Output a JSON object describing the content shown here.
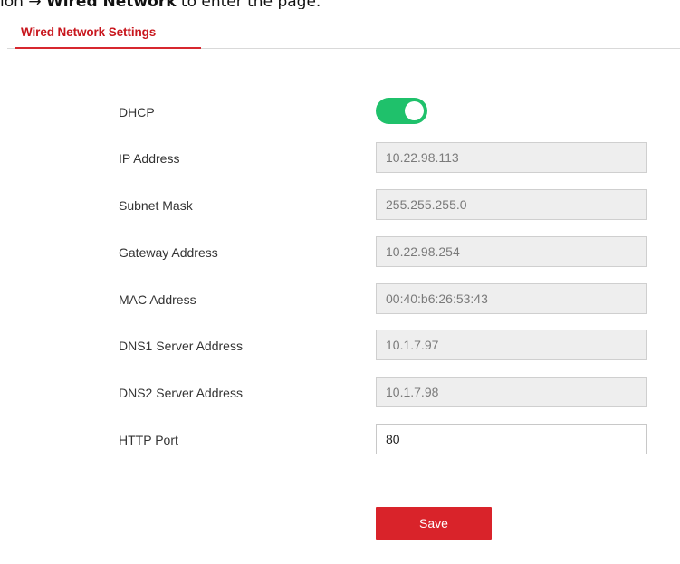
{
  "caption": {
    "prefix": "ion",
    "arrow": "→",
    "bold": "Wired Network",
    "suffix": "to enter the page."
  },
  "tab": {
    "label": "Wired Network Settings"
  },
  "accent_color": "#d7282f",
  "toggle_color": "#1fc16b",
  "dhcp": {
    "label": "DHCP",
    "enabled": true
  },
  "fields": {
    "ip": {
      "label": "IP Address",
      "value": "10.22.98.113"
    },
    "subnet": {
      "label": "Subnet Mask",
      "value": "255.255.255.0"
    },
    "gateway": {
      "label": "Gateway Address",
      "value": "10.22.98.254"
    },
    "mac": {
      "label": "MAC Address",
      "value": "00:40:b6:26:53:43"
    },
    "dns1": {
      "label": "DNS1 Server Address",
      "value": "10.1.7.97"
    },
    "dns2": {
      "label": "DNS2 Server Address",
      "value": "10.1.7.98"
    },
    "http": {
      "label": "HTTP Port",
      "value": "80"
    }
  },
  "save_label": "Save"
}
